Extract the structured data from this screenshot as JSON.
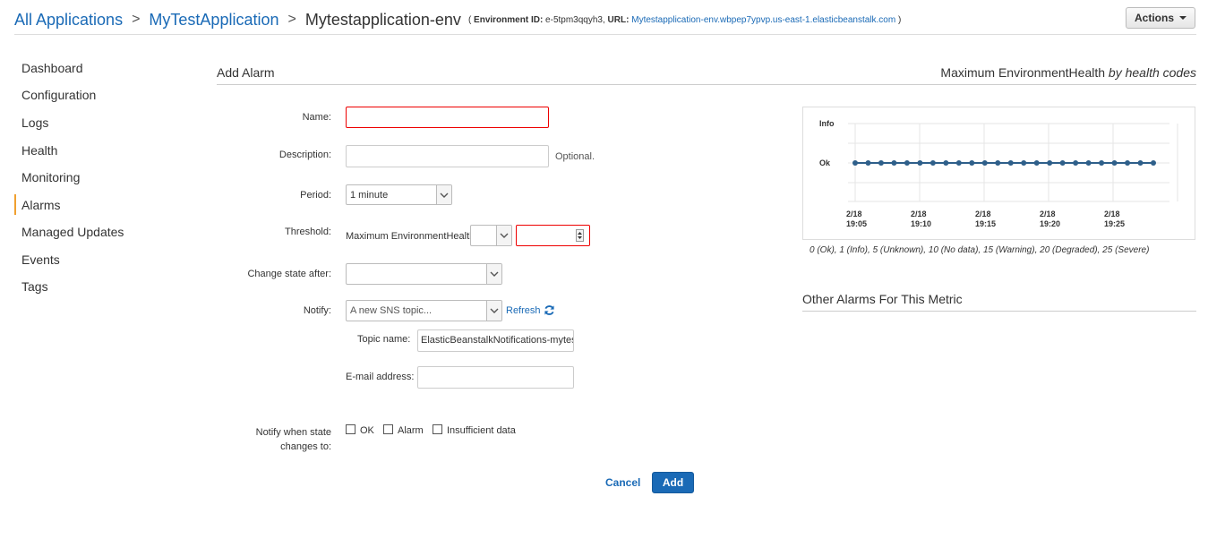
{
  "breadcrumb": {
    "all_apps": "All Applications",
    "sep1": ">",
    "app": "MyTestApplication",
    "sep2": ">",
    "env": "Mytestapplication-env",
    "env_info_open": "( ",
    "env_id_label": "Environment ID:",
    "env_id": " e-5tpm3qqyh3,",
    "url_label": " URL:",
    "url": "Mytestapplication-env.wbpep7ypvp.us-east-1.elasticbeanstalk.com",
    "env_info_close": " )"
  },
  "actions_label": "Actions",
  "sidebar": {
    "items": [
      {
        "label": "Dashboard"
      },
      {
        "label": "Configuration"
      },
      {
        "label": "Logs"
      },
      {
        "label": "Health"
      },
      {
        "label": "Monitoring"
      },
      {
        "label": "Alarms",
        "active": true
      },
      {
        "label": "Managed Updates"
      },
      {
        "label": "Events"
      },
      {
        "label": "Tags"
      }
    ]
  },
  "add_alarm": {
    "title": "Add Alarm",
    "name_label": "Name:",
    "name_value": "",
    "description_label": "Description:",
    "description_value": "",
    "optional_text": "Optional.",
    "period_label": "Period:",
    "period_value": "1 minute",
    "threshold_label": "Threshold:",
    "threshold_metric": "Maximum EnvironmentHealth",
    "threshold_operator": "",
    "threshold_value": "",
    "change_state_label": "Change state after:",
    "change_state_value": "",
    "notify_label": "Notify:",
    "notify_value": "A new SNS topic...",
    "refresh_label": "Refresh",
    "topic_name_label": "Topic name:",
    "topic_name_value": "ElasticBeanstalkNotifications-mytes",
    "email_label": "E-mail address:",
    "email_value": "",
    "notify_when_label_1": "Notify when state",
    "notify_when_label_2": "changes to:",
    "checkboxes": [
      {
        "label": "OK",
        "checked": false
      },
      {
        "label": "Alarm",
        "checked": false
      },
      {
        "label": "Insufficient data",
        "checked": false
      }
    ],
    "cancel_label": "Cancel",
    "add_label": "Add"
  },
  "metric_panel": {
    "title_main": "Maximum EnvironmentHealth ",
    "title_italic": "by health codes",
    "legend_text": "0 (Ok), 1 (Info), 5 (Unknown), 10 (No data), 15 (Warning), 20 (Degraded), 25 (Severe)"
  },
  "other_alarms": {
    "title": "Other Alarms For This Metric"
  },
  "colors": {
    "accent": "#1a6ab6",
    "active_nav": "#f0a030",
    "error_border": "#e00000",
    "line": "#2e5f8a"
  },
  "chart_data": {
    "type": "line",
    "y_categories": [
      "Ok",
      "Info"
    ],
    "x_ticks": [
      "2/18 19:05",
      "2/18 19:10",
      "2/18 19:15",
      "2/18 19:20",
      "2/18 19:25"
    ],
    "series": [
      {
        "values": [
          "Ok",
          "Ok",
          "Ok",
          "Ok",
          "Ok",
          "Ok",
          "Ok",
          "Ok",
          "Ok",
          "Ok",
          "Ok",
          "Ok",
          "Ok",
          "Ok",
          "Ok",
          "Ok",
          "Ok",
          "Ok",
          "Ok",
          "Ok",
          "Ok",
          "Ok",
          "Ok",
          "Ok"
        ]
      }
    ],
    "grid": true
  }
}
